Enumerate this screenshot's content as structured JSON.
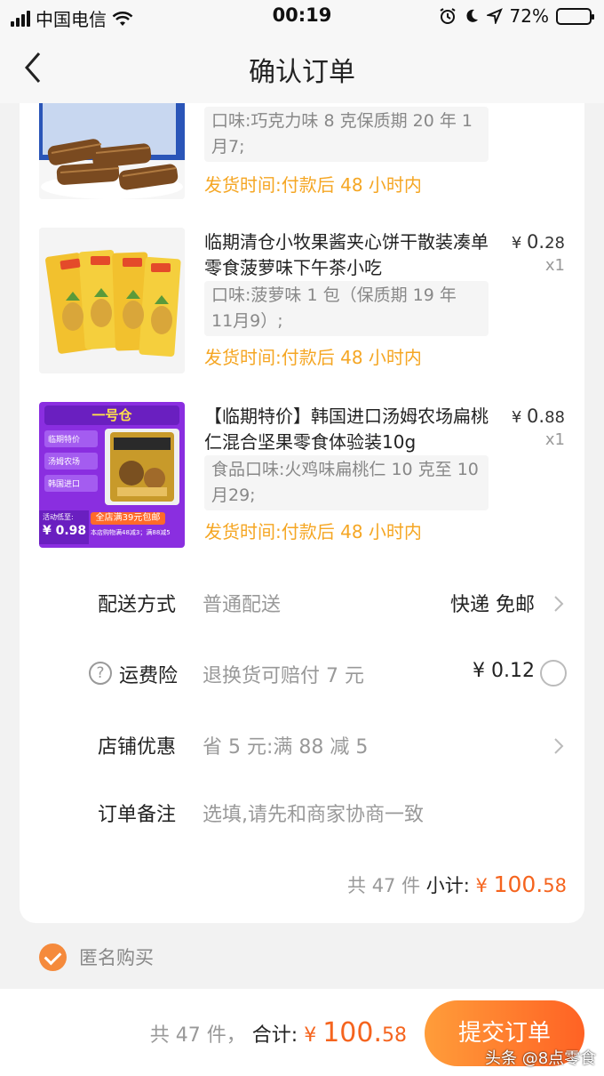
{
  "status_bar": {
    "carrier": "中国电信",
    "time": "00:19",
    "battery": "72%"
  },
  "nav": {
    "title": "确认订单"
  },
  "products": [
    {
      "attr": "口味:巧克力味 8 克保质期 20 年 1月7;",
      "ship": "发货时间:付款后 48 小时内"
    },
    {
      "name": "临期清仓小牧果酱夹心饼干散装凑单零食菠萝味下午茶小吃",
      "price_symbol": "¥",
      "price_int": "0.",
      "price_dec": "28",
      "qty": "x1",
      "attr": "口味:菠萝味 1 包（保质期 19 年 11月9）;",
      "ship": "发货时间:付款后 48 小时内"
    },
    {
      "name": "【临期特价】韩国进口汤姆农场扁桃仁混合坚果零食体验装10g",
      "price_symbol": "¥",
      "price_int": "0.",
      "price_dec": "88",
      "qty": "x1",
      "attr": "食品口味:火鸡味扁桃仁 10 克至 10月29;",
      "ship": "发货时间:付款后 48 小时内",
      "thumb": {
        "brand": "一号仓",
        "tags": [
          "临期特价",
          "汤姆农场",
          "韩国进口"
        ],
        "promo_label": "活动低至:",
        "promo_price": "¥ 0.98",
        "promo_banner": "全店满39元包邮",
        "promo_sub": "本店购物满48减3；满88减5"
      }
    }
  ],
  "delivery": {
    "label": "配送方式",
    "value": "普通配送",
    "right": "快递 免邮"
  },
  "insurance": {
    "label": "运费险",
    "value": "退换货可赔付 7 元",
    "price": "¥ 0.12"
  },
  "discount": {
    "label": "店铺优惠",
    "value": "省 5 元:满 88 减 5"
  },
  "remark": {
    "label": "订单备注",
    "placeholder": "选填,请先和商家协商一致"
  },
  "subtotal": {
    "count": "共 47 件",
    "label": "小计:",
    "symbol": "¥ ",
    "int": "100.",
    "dec": "58"
  },
  "anonymous": {
    "label": "匿名购买"
  },
  "footer": {
    "count": "共 47 件，",
    "label": "合计:",
    "symbol": "¥ ",
    "int": "100.",
    "dec": "58",
    "submit": "提交订单"
  },
  "watermark": "头条 @8点零食",
  "colors": {
    "accent": "#f5641e",
    "ship": "#f5a623",
    "button_from": "#ff9d3a",
    "button_to": "#ff6224"
  }
}
